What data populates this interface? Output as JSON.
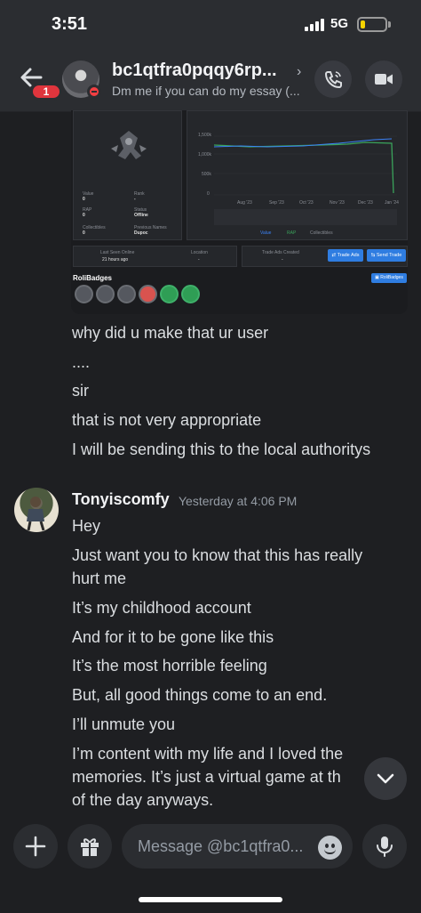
{
  "status_bar": {
    "time": "3:51",
    "network": "5G",
    "battery_level": 0.2
  },
  "header": {
    "title": "bc1qtfra0pqqy6rp...",
    "subtitle": "Dm me if you can do my essay (...",
    "back_badge": "1",
    "icons": [
      "back-arrow-icon",
      "call-icon",
      "video-icon",
      "chevron-right-icon"
    ]
  },
  "embed": {
    "chart_axis": [
      "1,500k",
      "1,000k",
      "500k",
      "0",
      "Aug '23",
      "Sep '23",
      "Oct '23",
      "Nov '23",
      "Dec '23",
      "Jan '24"
    ],
    "chart_legend": [
      "Value",
      "RAP",
      "Collectibles"
    ],
    "stats": [
      {
        "label": "Value",
        "value": "0"
      },
      {
        "label": "Rank",
        "value": "-"
      },
      {
        "label": "RAP",
        "value": "0"
      },
      {
        "label": "Status",
        "value": "Offline"
      },
      {
        "label": "Collectibles",
        "value": "0"
      },
      {
        "label": "Previous Names",
        "value": "Dupoc"
      }
    ],
    "last_seen_label": "Last Seen Online",
    "last_seen_value": "21 hours ago",
    "location_label": "Location",
    "location_value": "-",
    "trade_ads_label": "Trade Ads Created",
    "trade_ads_value": "-",
    "trade_ads_button": "Trade Ads",
    "send_trade_button": "Send Trade",
    "badges_title": "RoliBadges",
    "badges_button": "RoliBadges"
  },
  "messages_prev": [
    "why did u make that ur user",
    "....",
    "sir",
    "that is not very appropriate",
    "I will be sending this to the local authoritys"
  ],
  "author": {
    "name": "Tonyiscomfy",
    "timestamp": "Yesterday at 4:06 PM"
  },
  "messages_author": [
    "Hey",
    "Just want you to know that this has really",
    "hurt me",
    "It’s my childhood account",
    "And for it to be gone like this",
    "It’s the most horrible feeling",
    "But, all good things come to an end.",
    "I’ll unmute you",
    "I’m content with my life and I loved the",
    "memories. It’s just a virtual game at th",
    "of the day anyways."
  ],
  "composer": {
    "placeholder": "Message @bc1qtfra0..."
  }
}
